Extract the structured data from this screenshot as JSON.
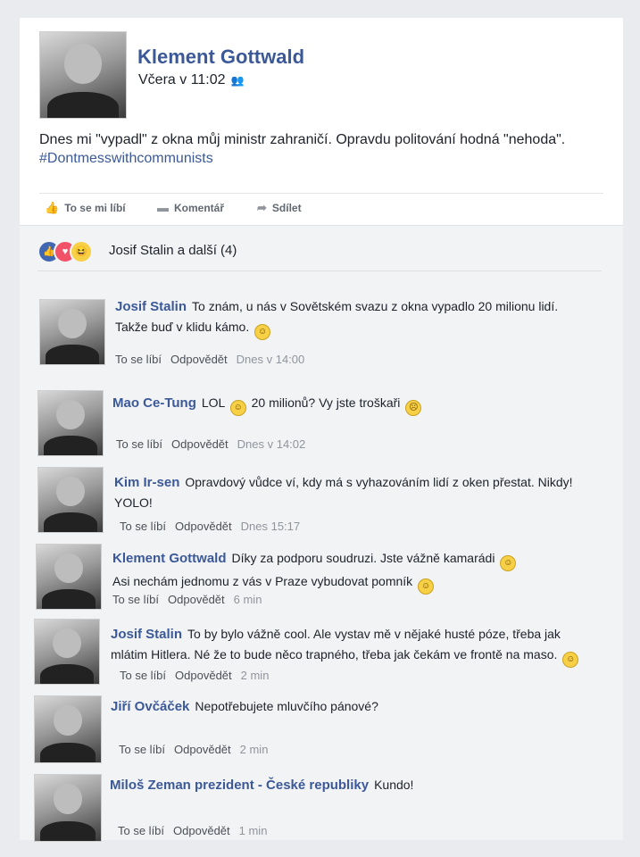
{
  "post": {
    "author": "Klement Gottwald",
    "time": "Včera v 11:02",
    "text": "Dnes mi \"vypadl\" z okna můj ministr zahraničí. Opravdu politování hodná \"nehoda\".",
    "hashtag": "#Dontmesswithcommunists",
    "actions": {
      "like": "To se mi líbí",
      "comment": "Komentář",
      "share": "Sdílet"
    }
  },
  "reactions": {
    "summary": "Josif Stalin a další (4)"
  },
  "comments": [
    {
      "name": "Josif Stalin",
      "lines": [
        "To znám, u nás v Sovětském svazu z okna vypadlo 20 milionu lidí.",
        "Takže buď v klidu kámo."
      ],
      "like": "To se líbí",
      "reply": "Odpovědět",
      "time": "Dnes v 14:00"
    },
    {
      "name": "Mao Ce-Tung",
      "lines": [
        "LOL",
        "20 milionů? Vy jste troškaři"
      ],
      "like": "To se líbí",
      "reply": "Odpovědět",
      "time": "Dnes v 14:02"
    },
    {
      "name": "Kim Ir-sen",
      "lines": [
        "Opravdový vůdce ví, kdy má s vyhazováním lidí z oken přestat. Nikdy!",
        "YOLO!"
      ],
      "like": "To se líbí",
      "reply": "Odpovědět",
      "time": "Dnes 15:17"
    },
    {
      "name": "Klement Gottwald",
      "lines": [
        "Díky za podporu soudruzi. Jste vážně kamarádi",
        "Asi nechám jednomu z vás v Praze vybudovat pomník"
      ],
      "like": "To se líbí",
      "reply": "Odpovědět",
      "time": "6 min"
    },
    {
      "name": "Josif Stalin",
      "lines": [
        "To by bylo vážně cool. Ale vystav mě v nějaké husté póze, třeba jak",
        "mlátim Hitlera. Né že to bude něco trapného, třeba jak čekám ve frontě na maso."
      ],
      "like": "To se líbí",
      "reply": "Odpovědět",
      "time": "2 min"
    },
    {
      "name": "Jiří Ovčáček",
      "lines": [
        "Nepotřebujete mluvčího pánové?"
      ],
      "like": "To se líbí",
      "reply": "Odpovědět",
      "time": "2 min"
    },
    {
      "name": "Miloš Zeman prezident - České republiky",
      "lines": [
        "Kundo!"
      ],
      "like": "To se líbí",
      "reply": "Odpovědět",
      "time": "1 min"
    }
  ],
  "icons": {
    "like": "thumbs-up-icon",
    "comment": "speech-bubble-icon",
    "share": "share-arrow-icon",
    "audience": "friends-icon",
    "emoji": "smiley-emoji-icon"
  },
  "colors": {
    "brand": "#3b5998",
    "panel": "#f2f3f5",
    "like": "#4267b2",
    "love": "#f25268",
    "haha": "#f7d046"
  }
}
